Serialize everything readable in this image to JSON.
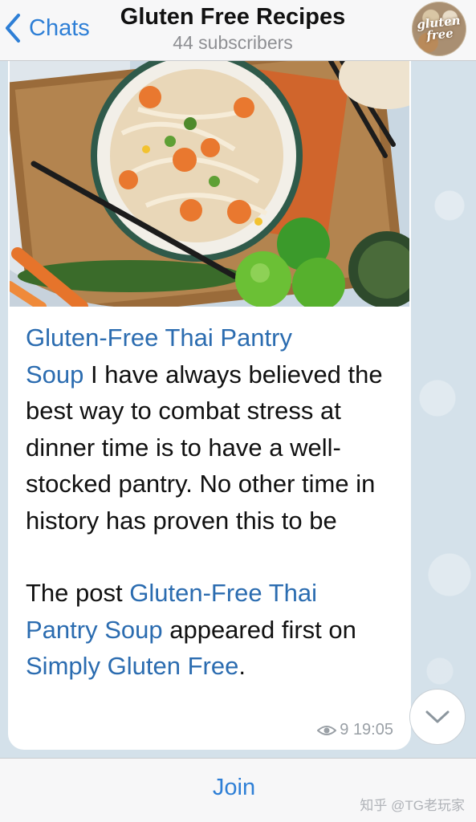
{
  "header": {
    "back_label": "Chats",
    "title": "Gluten Free Recipes",
    "subtitle": "44 subscribers",
    "avatar_text_line1": "gluten",
    "avatar_text_line2": "free"
  },
  "message": {
    "link_title_part1": "Gluten-Free Thai Pantry",
    "link_title_part2": "Soup",
    "body_text": " I have always believed the best way to combat stress at dinner time is to have a well-stocked pantry. No other time in history has proven this to be",
    "footer_prefix": "The post ",
    "footer_link_post_part1": "Gluten-Free Thai",
    "footer_link_post_part2": "Pantry Soup",
    "footer_middle": " appeared first on ",
    "footer_link_site": "Simply Gluten Free",
    "footer_suffix": ".",
    "views": "9",
    "time": "19:05"
  },
  "bottom": {
    "join_label": "Join",
    "watermark": "知乎 @TG老玩家"
  },
  "icons": {
    "back": "chevron-left-icon",
    "views": "eye-icon",
    "scroll": "chevron-down-icon"
  },
  "colors": {
    "accent": "#2e7fd6",
    "link": "#2b6cb0",
    "background": "#d4e1ea"
  }
}
